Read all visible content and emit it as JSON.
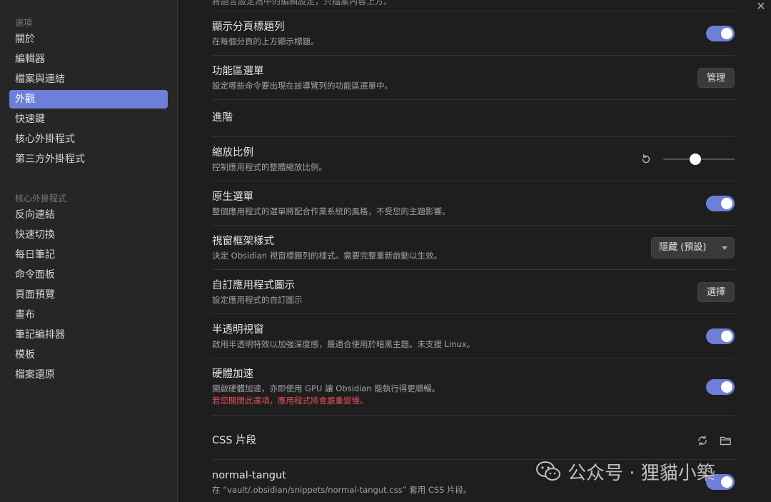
{
  "window": {
    "close_glyph": "✕"
  },
  "sidebar": {
    "options_title": "選項",
    "options_items": [
      {
        "label": "關於"
      },
      {
        "label": "編輯器"
      },
      {
        "label": "檔案與連結"
      },
      {
        "label": "外觀",
        "active": true
      },
      {
        "label": "快速鍵"
      },
      {
        "label": "核心外掛程式"
      },
      {
        "label": "第三方外掛程式"
      }
    ],
    "core_title": "核心外掛程式",
    "core_items": [
      {
        "label": "反向連結"
      },
      {
        "label": "快速切換"
      },
      {
        "label": "每日筆記"
      },
      {
        "label": "命令面板"
      },
      {
        "label": "頁面預覽"
      },
      {
        "label": "畫布"
      },
      {
        "label": "筆記編排器"
      },
      {
        "label": "模板"
      },
      {
        "label": "檔案還原"
      }
    ]
  },
  "content": {
    "top_cut_text": "將語言設定為中的編輯設定，只檔案內容上方。",
    "tab_title_bar": {
      "name": "顯示分頁標題列",
      "desc": "在每個分頁的上方顯示標題。",
      "enabled": true
    },
    "ribbon_menu": {
      "name": "功能區選單",
      "desc": "設定哪些命令要出現在該導覽列的功能區選單中。",
      "button": "管理"
    },
    "advanced_heading": "進階",
    "zoom": {
      "name": "縮放比例",
      "desc": "控制應用程式的整體縮放比例。",
      "value_fraction": 0.45
    },
    "native_menu": {
      "name": "原生選單",
      "desc": "整個應用程式的選單將配合作業系統的風格，不受您的主題影響。",
      "enabled": true
    },
    "frame_style": {
      "name": "視窗框架樣式",
      "desc": "決定 Obsidian 視窗標題列的樣式。需要完整重新啟動以生效。",
      "selected": "隱藏 (預設)"
    },
    "custom_icon": {
      "name": "自訂應用程式圖示",
      "desc": "設定應用程式的自訂圖示",
      "button": "選擇"
    },
    "translucent": {
      "name": "半透明視窗",
      "desc": "啟用半透明特效以加強深度感，最適合使用於暗黑主題。未支援 Linux。",
      "enabled": true
    },
    "hw_accel": {
      "name": "硬體加速",
      "desc": "開啟硬體加速，亦即使用 GPU 讓 Obsidian 能執行得更順暢。",
      "warning": "若您關閉此選項，應用程式將會嚴重變慢。",
      "enabled": true
    },
    "css_heading": "CSS 片段",
    "snippet": {
      "name": "normal-tangut",
      "desc": "在 “vault/.obsidian/snippets/normal-tangut.css” 套用 CSS 片段。",
      "enabled": true
    }
  },
  "watermark": {
    "text": "公众号 · 狸貓小築"
  },
  "colors": {
    "accent": "#6e7fd8",
    "warning": "#e0505a"
  },
  "icons": {
    "reload": "reload-icon",
    "folder": "folder-icon",
    "reset": "reset-icon"
  }
}
